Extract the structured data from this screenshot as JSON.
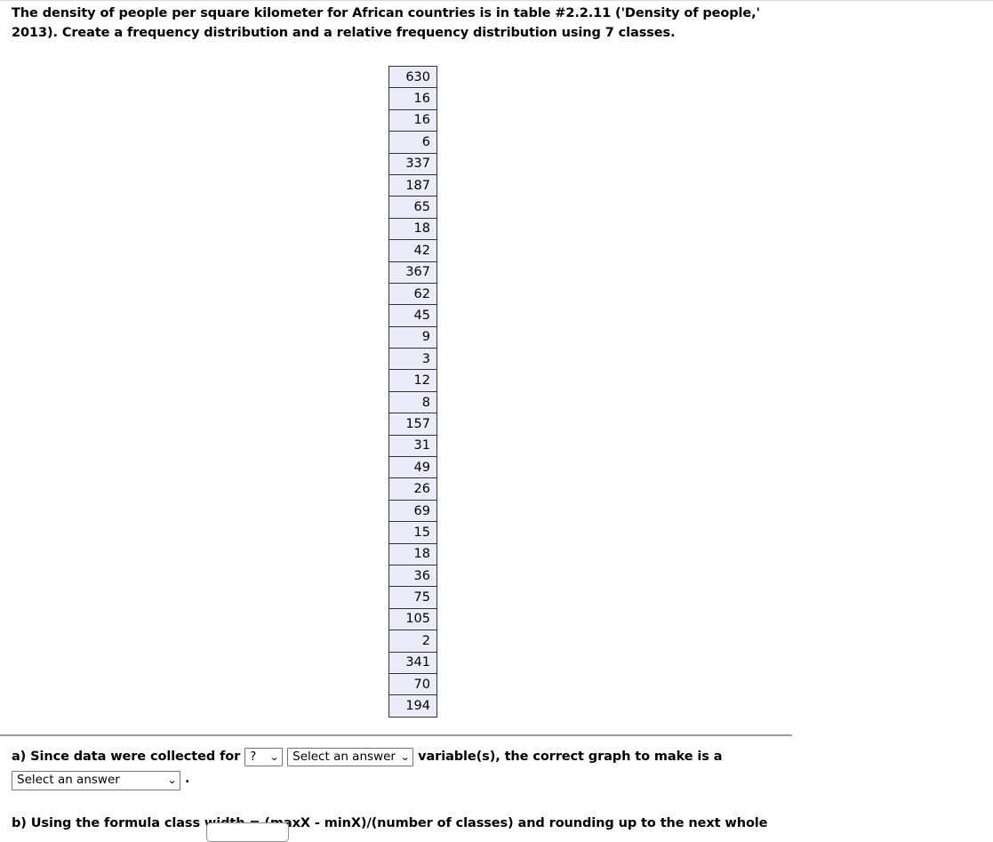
{
  "prompt": {
    "text": "The density of people per square kilometer for African countries is in table #2.2.11 ('Density of people,' 2013). Create a frequency distribution and a relative frequency distribution using 7 classes."
  },
  "data_table": {
    "values": [
      630,
      16,
      16,
      6,
      337,
      187,
      65,
      18,
      42,
      367,
      62,
      45,
      9,
      3,
      12,
      8,
      157,
      31,
      49,
      26,
      69,
      15,
      18,
      36,
      75,
      105,
      2,
      341,
      70,
      194
    ]
  },
  "answers": {
    "part_a": {
      "text_before": "a) Since data were collected for",
      "count_select_value": "?",
      "type_select_value": "Select an answer",
      "text_middle": "variable(s), the correct graph to make is a",
      "graph_select_value": "Select an answer",
      "text_after": "."
    },
    "part_b": {
      "text": "b) Using the formula class width = (maxX - minX)/(number of classes) and rounding up to the next whole"
    }
  },
  "icons": {
    "chevron_down": "⌄"
  },
  "colors": {
    "cell_background": "#ecebfa",
    "cell_border": "#333333",
    "separator": "#9c9c9c",
    "control_border": "#767676"
  }
}
